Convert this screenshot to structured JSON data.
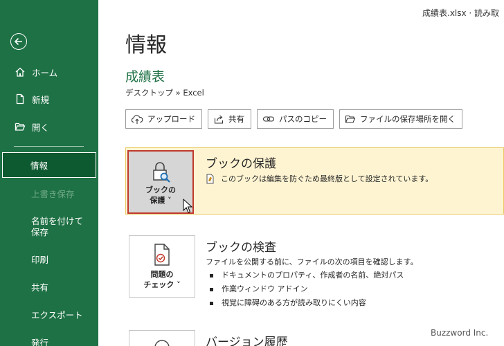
{
  "window": {
    "filename": "成績表.xlsx  ·  読み取"
  },
  "sidebar": {
    "items": [
      {
        "label": "ホーム",
        "icon": "home-icon"
      },
      {
        "label": "新規",
        "icon": "new-doc-icon"
      },
      {
        "label": "開く",
        "icon": "folder-open-icon"
      },
      {
        "label": "情報"
      },
      {
        "label": "上書き保存"
      },
      {
        "label": "名前を付けて保存"
      },
      {
        "label": "印刷"
      },
      {
        "label": "共有"
      },
      {
        "label": "エクスポート"
      },
      {
        "label": "発行"
      }
    ],
    "colors": {
      "background": "#1e7145",
      "active": "#0e5a30"
    }
  },
  "main": {
    "page_title": "情報",
    "doc_title": "成績表",
    "doc_path": "デスクトップ » Excel",
    "actions": [
      {
        "label": "アップロード",
        "icon": "cloud-upload-icon"
      },
      {
        "label": "共有",
        "icon": "share-icon"
      },
      {
        "label": "パスのコピー",
        "icon": "link-icon"
      },
      {
        "label": "ファイルの保存場所を開く",
        "icon": "folder-icon"
      }
    ],
    "protect": {
      "button_line1": "ブックの",
      "button_line2": "保護 ˅",
      "heading": "ブックの保護",
      "description": "このブックは編集を防ぐため最終版として設定されています。",
      "highlight_color": "#fef4d2"
    },
    "inspect": {
      "button_line1": "問題の",
      "button_line2": "チェック ˅",
      "heading": "ブックの検査",
      "description": "ファイルを公開する前に、ファイルの次の項目を確認します。",
      "bullets": [
        "ドキュメントのプロパティ、作成者の名前、絶対パス",
        "作業ウィンドウ アドイン",
        "視覚に障碍のある方が読み取りにくい内容"
      ]
    },
    "versions": {
      "heading": "バージョン履歴"
    }
  },
  "watermark": "Buzzword Inc."
}
